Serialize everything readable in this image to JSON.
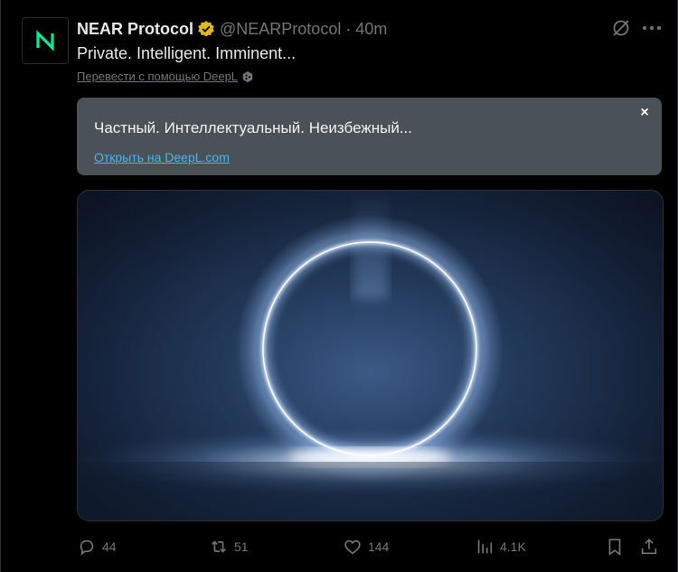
{
  "tweet": {
    "author_name": "NEAR Protocol",
    "handle": "@NEARProtocol",
    "separator": "·",
    "time": "40m",
    "text": "Private. Intelligent. Imminent...",
    "translate_link": "Перевести с помощью DeepL"
  },
  "translation": {
    "text": "Частный. Интеллектуальный. Неизбежный...",
    "open_link": "Открыть на DeepL.com",
    "close": "×"
  },
  "actions": {
    "replies": "44",
    "reposts": "51",
    "likes": "144",
    "views": "4.1K"
  },
  "colors": {
    "background": "#000000",
    "text": "#e7e9ea",
    "muted": "#71767b",
    "verified": "#e2b719",
    "near_green": "#00ec97",
    "deepl_link": "#4fb1f1",
    "translation_box": "#4b5257"
  },
  "icons": [
    "near-logo-icon",
    "verified-badge-icon",
    "grok-icon",
    "more-icon",
    "deepl-icon",
    "close-icon",
    "reply-icon",
    "repost-icon",
    "like-icon",
    "views-icon",
    "bookmark-icon",
    "share-icon"
  ]
}
